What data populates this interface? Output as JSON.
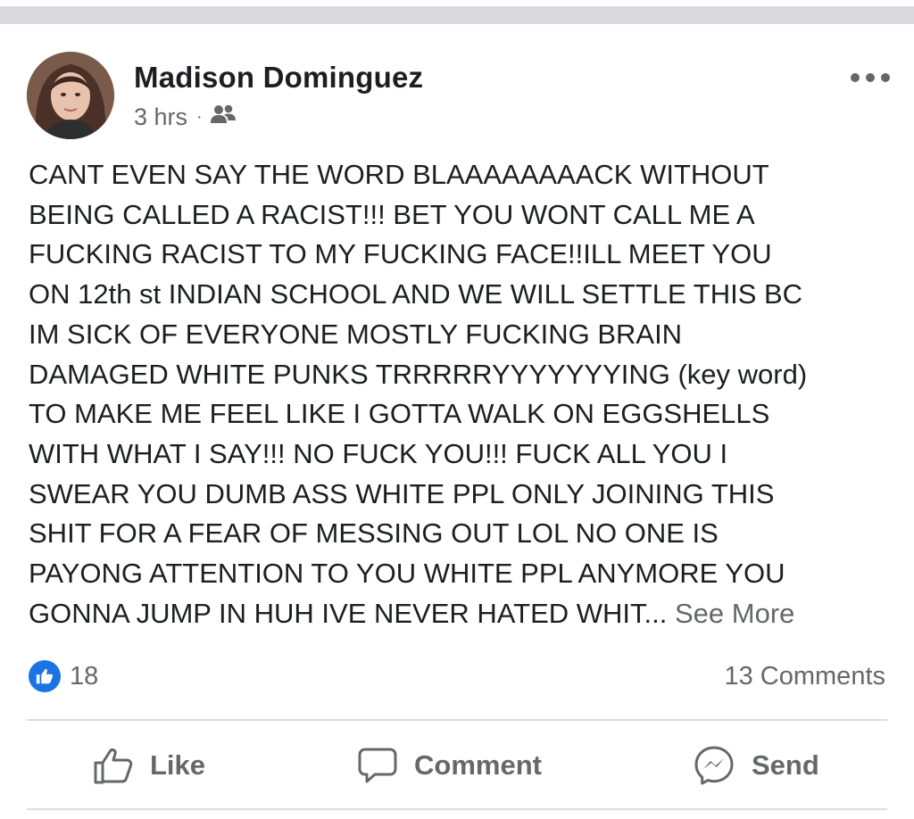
{
  "post": {
    "author": "Madison Dominguez",
    "time": "3 hrs",
    "separator": "·",
    "audience_icon": "friends-icon",
    "more_icon": "more-horizontal-icon",
    "body_lines": [
      "CANT EVEN SAY THE WORD BLAAAAAAAACK WITHOUT",
      "BEING CALLED A RACIST!!! BET YOU WONT CALL ME A",
      "FUCKING RACIST TO MY FUCKING FACE!!ILL MEET YOU",
      "ON 12th st INDIAN SCHOOL AND WE WILL SETTLE THIS BC",
      "IM SICK OF EVERYONE MOSTLY FUCKING BRAIN",
      "DAMAGED WHITE PUNKS TRRRRRYYYYYYYING (key word)",
      "TO MAKE ME FEEL LIKE I GOTTA WALK ON EGGSHELLS",
      "WITH WHAT I SAY!!! NO FUCK YOU!!! FUCK ALL YOU I",
      "SWEAR YOU DUMB ASS WHITE PPL ONLY JOINING THIS",
      "SHIT FOR A FEAR OF MESSING OUT LOL NO ONE IS",
      "PAYONG ATTENTION TO YOU WHITE PPL ANYMORE YOU",
      "GONNA JUMP IN HUH IVE NEVER HATED WHIT... "
    ],
    "see_more": "See More"
  },
  "stats": {
    "reaction_icon": "like-reaction-icon",
    "reaction_count": "18",
    "comments": "13 Comments"
  },
  "actions": {
    "like": "Like",
    "comment": "Comment",
    "send": "Send"
  },
  "colors": {
    "accent": "#1b74e4",
    "secondary_text": "#65676b",
    "divider": "#dadde1"
  }
}
